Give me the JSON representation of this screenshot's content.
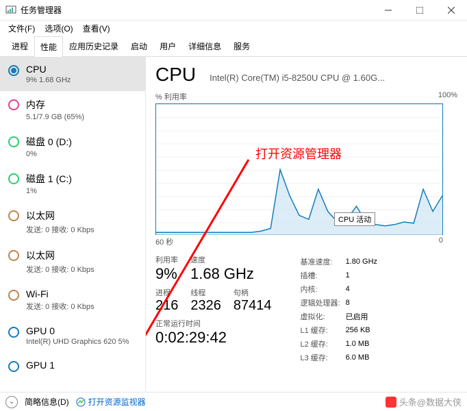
{
  "window": {
    "title": "任务管理器"
  },
  "menubar": [
    "文件(F)",
    "选项(O)",
    "查看(V)"
  ],
  "tabs": [
    "进程",
    "性能",
    "应用历史记录",
    "启动",
    "用户",
    "详细信息",
    "服务"
  ],
  "activeTab": 1,
  "sidebar": [
    {
      "title": "CPU",
      "sub": "9%  1.68 GHz",
      "color": "#117dbb",
      "filled": true,
      "selected": true
    },
    {
      "title": "内存",
      "sub": "5.1/7.9 GB (65%)",
      "color": "#e83e8c",
      "filled": false,
      "selected": false
    },
    {
      "title": "磁盘 0 (D:)",
      "sub": "0%",
      "color": "#2ecc71",
      "filled": false,
      "selected": false
    },
    {
      "title": "磁盘 1 (C:)",
      "sub": "1%",
      "color": "#2ecc71",
      "filled": false,
      "selected": false
    },
    {
      "title": "以太网",
      "sub": "发送: 0  接收: 0 Kbps",
      "color": "#c0844a",
      "filled": false,
      "selected": false
    },
    {
      "title": "以太网",
      "sub": "发送: 0  接收: 0 Kbps",
      "color": "#c0844a",
      "filled": false,
      "selected": false
    },
    {
      "title": "Wi-Fi",
      "sub": "发送: 0  接收: 0 Kbps",
      "color": "#c0844a",
      "filled": false,
      "selected": false
    },
    {
      "title": "GPU 0",
      "sub": "Intel(R) UHD Graphics 620\n5%",
      "color": "#117dbb",
      "filled": false,
      "selected": false
    },
    {
      "title": "GPU 1",
      "sub": "",
      "color": "#117dbb",
      "filled": false,
      "selected": false
    }
  ],
  "cpu": {
    "heading": "CPU",
    "model": "Intel(R) Core(TM) i5-8250U CPU @ 1.60G...",
    "graph": {
      "ylabel": "% 利用率",
      "ymax": "100%",
      "xleft": "60 秒",
      "xright": "0"
    },
    "tooltip": "CPU 活动",
    "stats": {
      "left": [
        {
          "label": "利用率",
          "val": "9%"
        },
        {
          "label": "速度",
          "val": "1.68 GHz"
        }
      ],
      "left2": [
        {
          "label": "进程",
          "val": "216"
        },
        {
          "label": "线程",
          "val": "2326"
        },
        {
          "label": "句柄",
          "val": "87414"
        }
      ],
      "right": [
        [
          "基准速度:",
          "1.80 GHz"
        ],
        [
          "插槽:",
          "1"
        ],
        [
          "内核:",
          "4"
        ],
        [
          "逻辑处理器:",
          "8"
        ],
        [
          "虚拟化:",
          "已启用"
        ],
        [
          "L1 缓存:",
          "256 KB"
        ],
        [
          "L2 缓存:",
          "1.0 MB"
        ],
        [
          "L3 缓存:",
          "6.0 MB"
        ]
      ]
    },
    "uptime": {
      "label": "正常运行时间",
      "val": "0:02:29:42"
    }
  },
  "annotation": "打开资源管理器",
  "footer": {
    "brief": "简略信息(D)",
    "resmon": "打开资源监视器"
  },
  "watermark": "头条@数据大侠",
  "chart_data": {
    "type": "line",
    "title": "% 利用率",
    "xlabel": "60 秒 → 0",
    "ylabel": "%",
    "ylim": [
      0,
      100
    ],
    "x": [
      60,
      58,
      56,
      54,
      52,
      50,
      48,
      46,
      44,
      42,
      40,
      38,
      36,
      34,
      32,
      30,
      28,
      26,
      24,
      22,
      20,
      18,
      16,
      14,
      12,
      10,
      8,
      6,
      4,
      2,
      0
    ],
    "values": [
      2,
      2,
      2,
      2,
      2,
      2,
      2,
      2,
      2,
      2,
      2,
      3,
      5,
      50,
      30,
      15,
      12,
      35,
      18,
      10,
      12,
      22,
      10,
      8,
      7,
      8,
      10,
      9,
      35,
      18,
      30
    ]
  }
}
